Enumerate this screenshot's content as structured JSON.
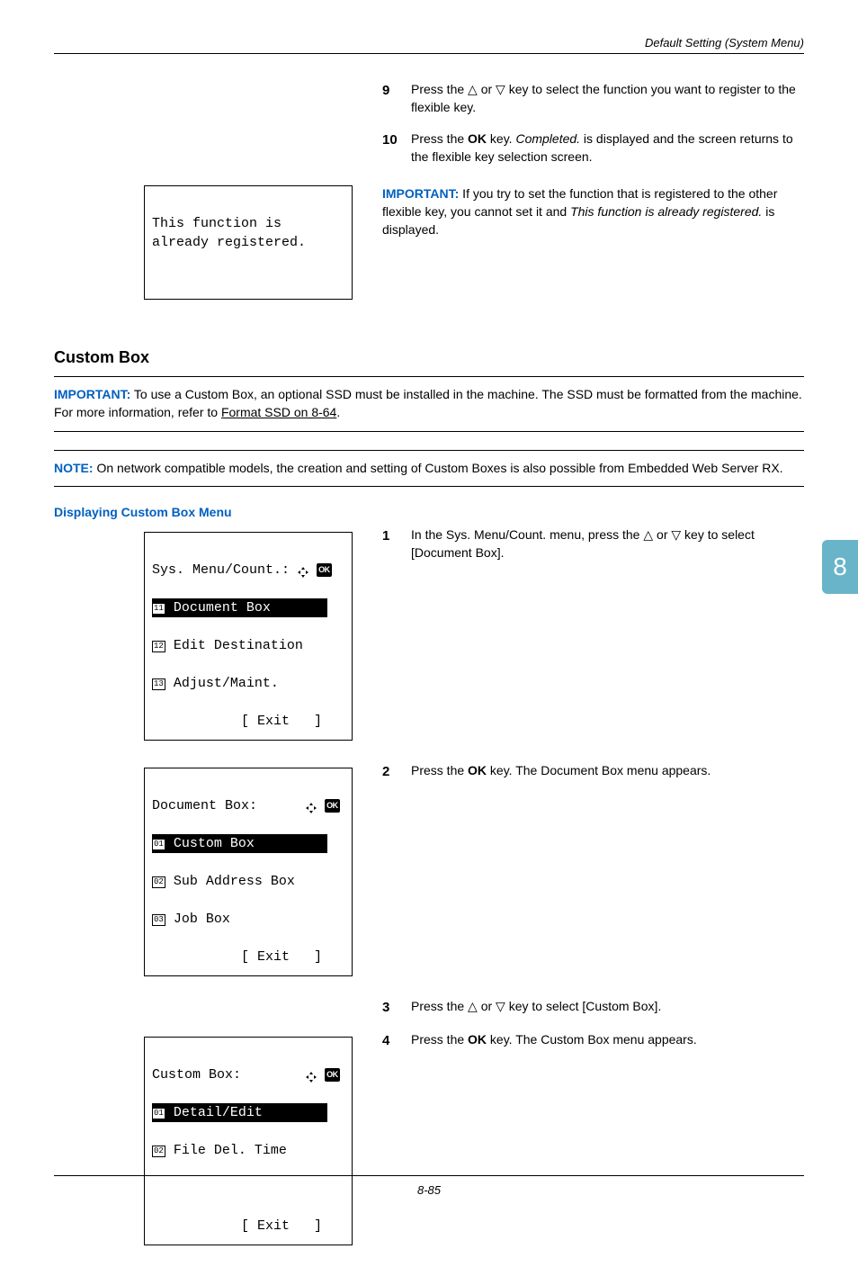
{
  "header": {
    "title": "Default Setting (System Menu)"
  },
  "steps_a": [
    {
      "n": "9",
      "text_a": "Press the ",
      "key1": "△",
      "text_b": " or ",
      "key2": "▽",
      "text_c": " key to select the function you want to register to the flexible key."
    },
    {
      "n": "10",
      "text_a": "Press the ",
      "bold": "OK",
      "text_b": " key. ",
      "ital": "Completed.",
      "text_c": " is displayed and the screen returns to the flexible key selection screen."
    }
  ],
  "important1": {
    "lead": "IMPORTANT:",
    "pre": " If you try to set the function that is registered to the other flexible key, you cannot set it and ",
    "ital": "This function is already registered.",
    "post": " is displayed."
  },
  "lcd_err": {
    "l1": "This function is",
    "l2": "already registered."
  },
  "heading": "Custom Box",
  "important2": {
    "lead": "IMPORTANT:",
    "text_a": " To use a Custom Box, an optional SSD must be installed in the machine. The SSD must be formatted from the machine. For more information, refer to ",
    "link": "Format SSD on 8-64",
    "text_b": "."
  },
  "note": {
    "lead": "NOTE:",
    "text": " On network compatible models, the creation and setting of Custom Boxes is also possible from Embedded Web Server RX."
  },
  "subhead": "Displaying Custom Box Menu",
  "lcd1": {
    "title": "Sys. Menu/Count.:",
    "n1": "11",
    "sel": " Document Box",
    "n2": "12",
    "i2": " Edit Destination",
    "n3": "13",
    "i3": " Adjust/Maint.",
    "exit": "[ Exit   ]"
  },
  "lcd2": {
    "title": "Document Box:",
    "n1": "01",
    "sel": " Custom Box",
    "n2": "02",
    "i2": " Sub Address Box",
    "n3": "03",
    "i3": " Job Box",
    "exit": "[ Exit   ]"
  },
  "lcd3": {
    "title": "Custom Box:",
    "n1": "01",
    "sel": " Detail/Edit",
    "n2": "02",
    "i2": " File Del. Time",
    "exit": "[ Exit   ]"
  },
  "steps_b": [
    {
      "n": "1",
      "text_a": "In the Sys. Menu/Count. menu, press the ",
      "key1": "△",
      "text_b": " or ",
      "key2": "▽",
      "text_c": " key to select [Document Box]."
    },
    {
      "n": "2",
      "text_a": "Press the ",
      "bold": "OK",
      "text_b": " key. The Document Box menu appears."
    },
    {
      "n": "3",
      "text_a": "Press the ",
      "key1": "△",
      "text_b": " or ",
      "key2": "▽",
      "text_c": " key to select [Custom Box]."
    },
    {
      "n": "4",
      "text_a": "Press the ",
      "bold": "OK",
      "text_b": " key. The Custom Box menu appears."
    }
  ],
  "sidetab": "8",
  "footer": "8-85"
}
